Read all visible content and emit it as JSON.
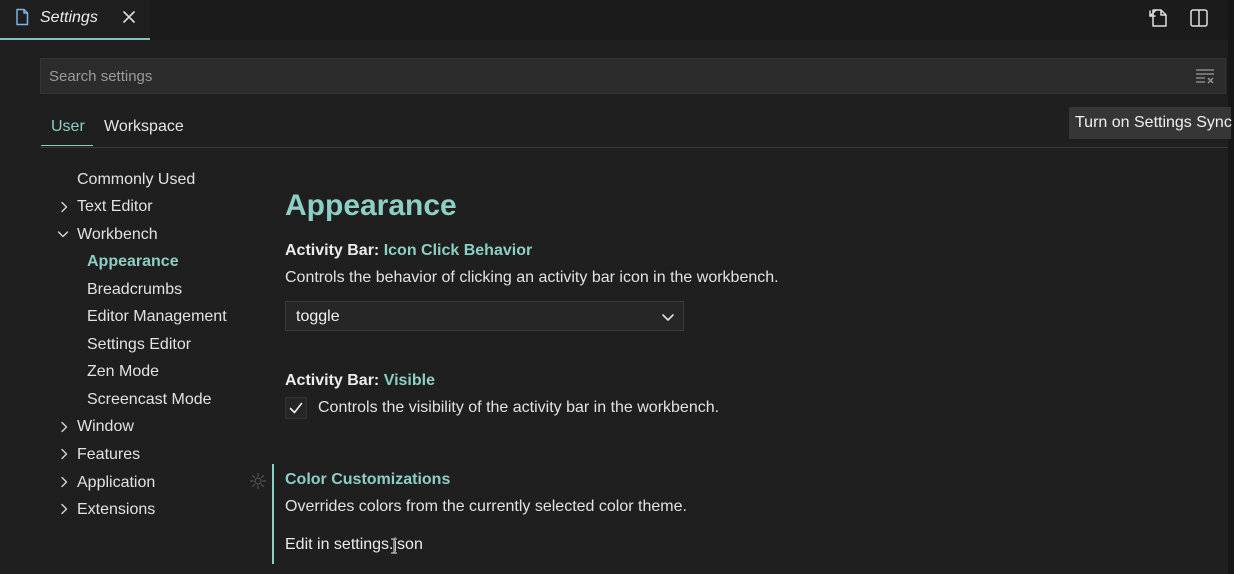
{
  "tab": {
    "label": "Settings",
    "close_icon": "close-icon",
    "file_icon": "file-icon"
  },
  "toolbar": {
    "open_json_icon": "open-settings-json-icon",
    "split_icon": "split-editor-icon"
  },
  "search": {
    "placeholder": "Search settings",
    "value": "",
    "clear_icon": "clear-filter-icon"
  },
  "scopes": [
    {
      "label": "User",
      "active": true
    },
    {
      "label": "Workspace",
      "active": false
    }
  ],
  "sync_button": {
    "label": "Turn on Settings Sync"
  },
  "toc": [
    {
      "label": "Commonly Used",
      "chevron": "none"
    },
    {
      "label": "Text Editor",
      "chevron": "right"
    },
    {
      "label": "Workbench",
      "chevron": "down"
    },
    {
      "label": "Appearance",
      "chevron": "none",
      "active": true
    },
    {
      "label": "Breadcrumbs",
      "chevron": "none"
    },
    {
      "label": "Editor Management",
      "chevron": "none"
    },
    {
      "label": "Settings Editor",
      "chevron": "none"
    },
    {
      "label": "Zen Mode",
      "chevron": "none"
    },
    {
      "label": "Screencast Mode",
      "chevron": "none"
    },
    {
      "label": "Window",
      "chevron": "right"
    },
    {
      "label": "Features",
      "chevron": "right"
    },
    {
      "label": "Application",
      "chevron": "right"
    },
    {
      "label": "Extensions",
      "chevron": "right"
    }
  ],
  "content": {
    "section_title": "Appearance",
    "settings": [
      {
        "category": "Activity Bar: ",
        "name": "Icon Click Behavior",
        "description": "Controls the behavior of clicking an activity bar icon in the workbench.",
        "dropdown_value": "toggle"
      },
      {
        "category": "Activity Bar: ",
        "name": "Visible",
        "description": "Controls the visibility of the activity bar in the workbench.",
        "checked": true
      },
      {
        "category": "",
        "name": "Color Customizations",
        "description": "Overrides colors from the currently selected color theme.",
        "link": "Edit in settings.json"
      }
    ]
  },
  "colors": {
    "accent": "#8ccfc4",
    "background": "#1f1f1f",
    "text": "#e2e2e2"
  }
}
